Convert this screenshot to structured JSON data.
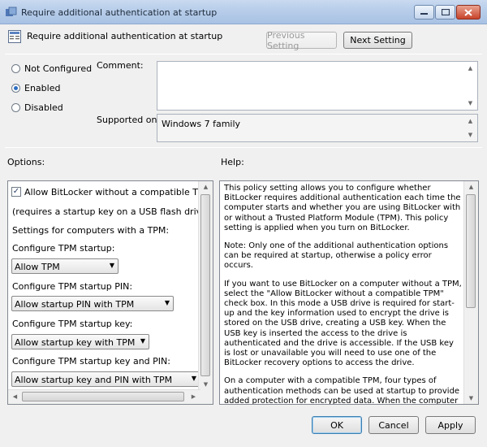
{
  "window": {
    "title": "Require additional authentication at startup"
  },
  "header": {
    "title": "Require additional authentication at startup",
    "prev_label": "Previous Setting",
    "next_label": "Next Setting"
  },
  "state": {
    "not_configured_label": "Not Configured",
    "enabled_label": "Enabled",
    "disabled_label": "Disabled",
    "selected": "Enabled"
  },
  "comment": {
    "label": "Comment:",
    "value": ""
  },
  "supported": {
    "label": "Supported on:",
    "value": "Windows 7 family"
  },
  "options": {
    "label": "Options:",
    "allow_without_tpm": {
      "label": "Allow BitLocker without a compatible TPM",
      "checked": true
    },
    "note": "(requires a startup key on a USB flash drive)",
    "settings_heading": "Settings for computers with a TPM:",
    "tpm_startup": {
      "label": "Configure TPM startup:",
      "value": "Allow TPM"
    },
    "tpm_pin": {
      "label": "Configure TPM startup PIN:",
      "value": "Allow startup PIN with TPM"
    },
    "tpm_key": {
      "label": "Configure TPM startup key:",
      "value": "Allow startup key with TPM"
    },
    "tpm_key_pin": {
      "label": "Configure TPM startup key and PIN:",
      "value": "Allow startup key and PIN with TPM"
    }
  },
  "help": {
    "label": "Help:",
    "paragraphs": [
      "This policy setting allows you to configure whether BitLocker requires additional authentication each time the computer starts and whether you are using BitLocker with or without a Trusted Platform Module (TPM). This policy setting is applied when you turn on BitLocker.",
      "Note: Only one of the additional authentication options can be required at startup, otherwise a policy error occurs.",
      "If you want to use BitLocker on a computer without a TPM, select the \"Allow BitLocker without a compatible TPM\" check box. In this mode a USB drive is required for start-up and the key information used to encrypt the drive is stored on the USB drive, creating a USB key. When the USB key is inserted the access to the drive is authenticated and the drive is accessible. If the USB key is lost or unavailable you will need to use one of the BitLocker recovery options to access the drive.",
      "On a computer with a compatible TPM, four types of authentication methods can be used at startup to provide added protection for encrypted data. When the computer starts, it can"
    ]
  },
  "footer": {
    "ok_label": "OK",
    "cancel_label": "Cancel",
    "apply_label": "Apply"
  },
  "colors": {
    "titlebar": "#b7cde9",
    "accent": "#2d6fc2",
    "close": "#c8442a"
  }
}
